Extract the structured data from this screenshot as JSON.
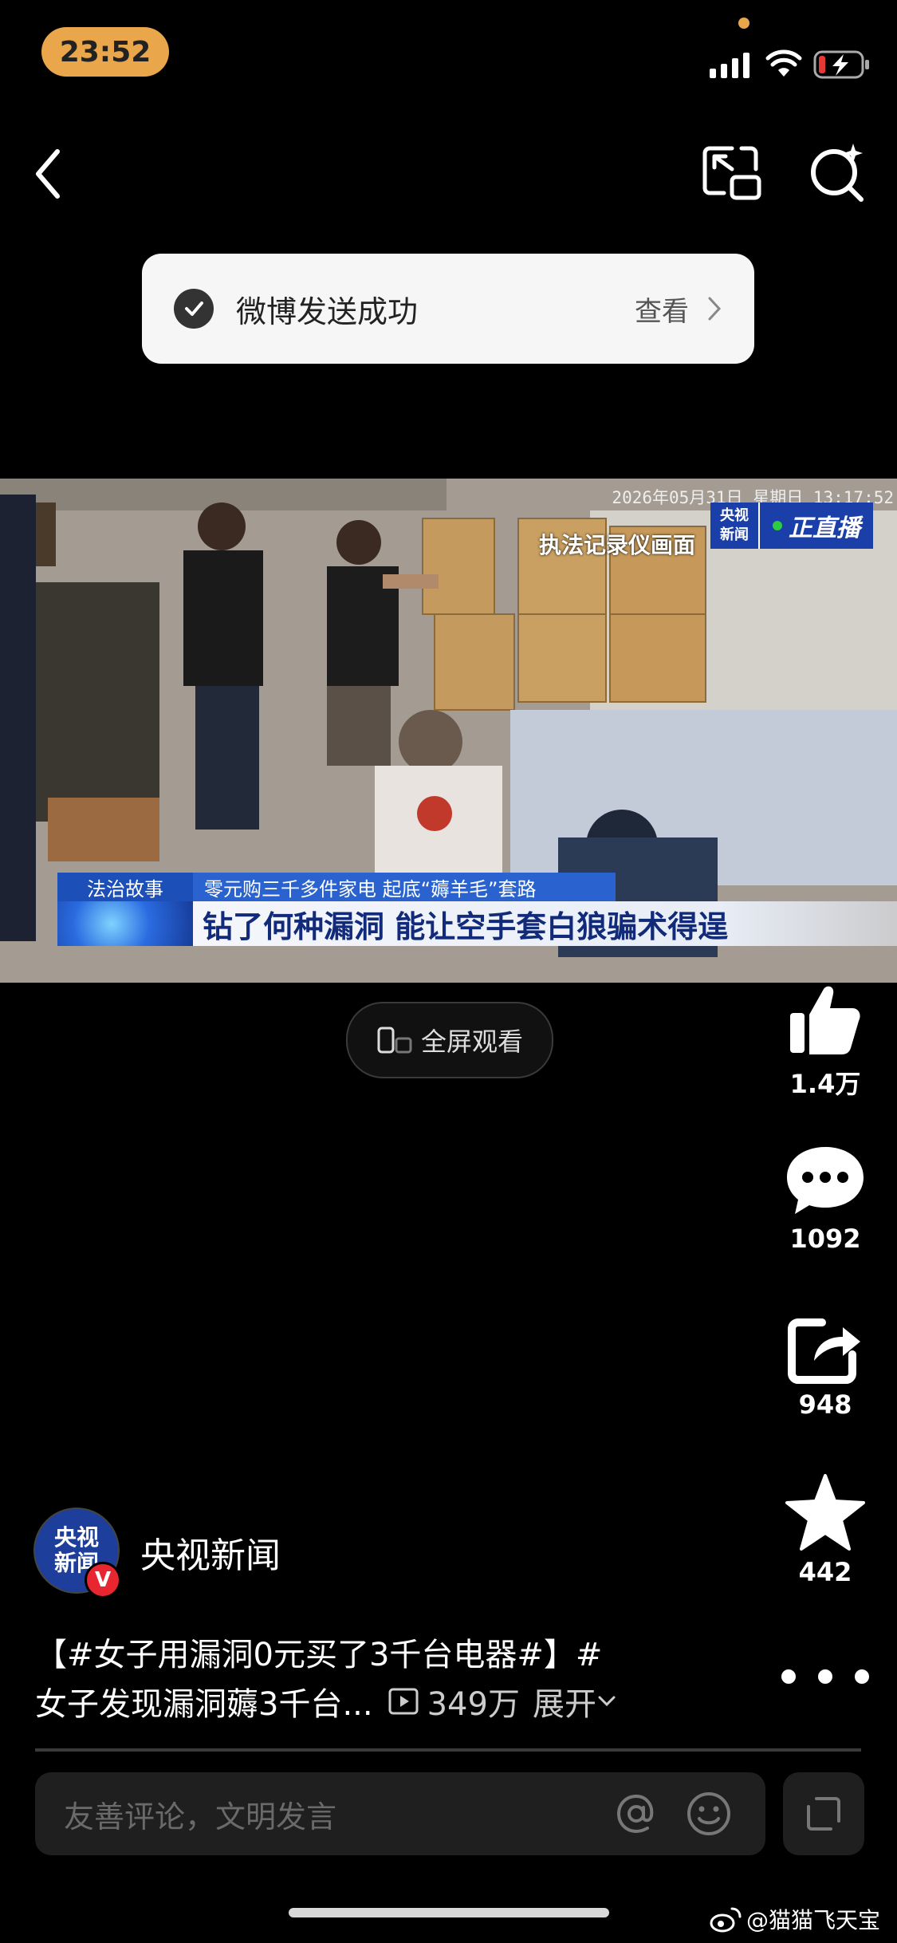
{
  "status_bar": {
    "time": "23:52"
  },
  "toast": {
    "message": "微博发送成功",
    "view_label": "查看"
  },
  "video": {
    "timestamp": "2026年05月31日 星期日 13:17:52",
    "logo_line1": "央视",
    "logo_line2": "新闻",
    "live_label": "正直播",
    "recorder_label": "执法记录仪画面",
    "tag": "法治故事",
    "subtitle": "零元购三千多件家电 起底“薅羊毛”套路",
    "headline": "钻了何种漏洞 能让空手套白狼骗术得逞"
  },
  "fullscreen": {
    "label": "全屏观看"
  },
  "actions": {
    "like_count": "1.4万",
    "comment_count": "1092",
    "share_count": "948",
    "favorite_count": "442"
  },
  "author": {
    "avatar_line1": "央视",
    "avatar_line2": "新闻",
    "verified_badge": "V",
    "name": "央视新闻"
  },
  "caption": {
    "line1": "【#女子用漏洞0元买了3千台电器#】#",
    "line2": "女子发现漏洞薅3千台...",
    "views": "349万",
    "expand_label": "展开"
  },
  "comment_input": {
    "placeholder": "友善评论，文明发言"
  },
  "watermark": {
    "text": "@猫猫飞天宝"
  },
  "colors": {
    "accent": "#e9a64a",
    "cctv_blue": "#1a3fa8",
    "verified_red": "#e8262f"
  }
}
